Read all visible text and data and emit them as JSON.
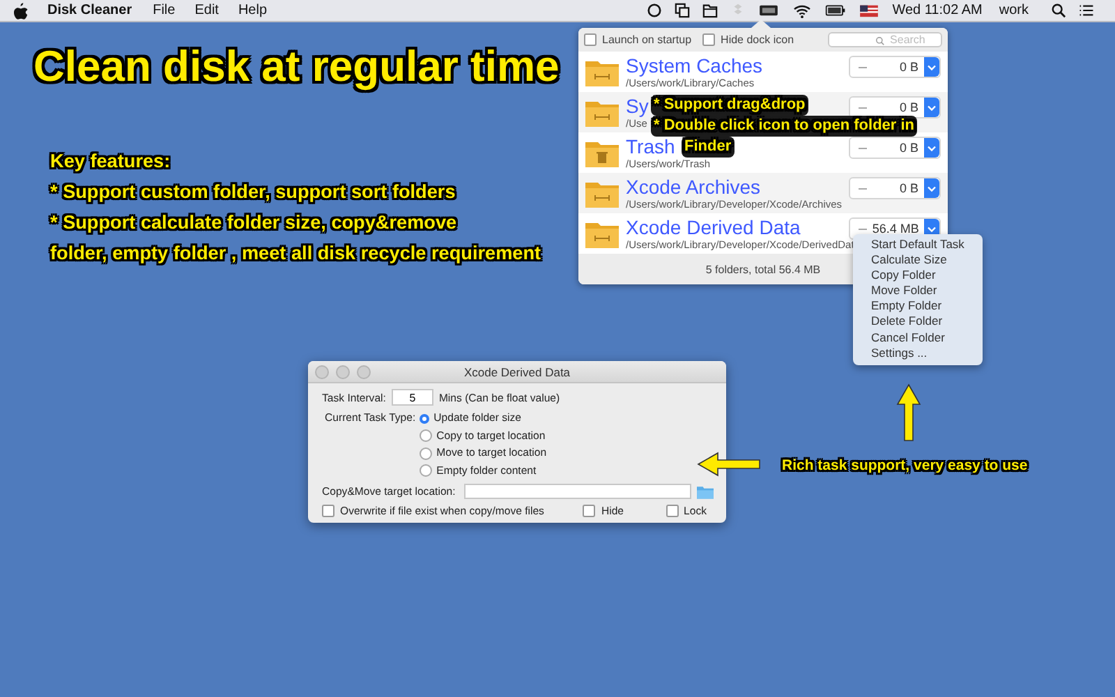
{
  "menu_bar": {
    "app_name": "Disk Cleaner",
    "menus": [
      "File",
      "Edit",
      "Help"
    ],
    "clock": "Wed 11:02 AM",
    "user": "work"
  },
  "headline": "Clean disk at regular time",
  "features": {
    "title": "Key features:",
    "lines": [
      "* Support custom folder, support sort folders",
      "* Support calculate folder size, copy&remove",
      "folder, empty folder  , meet all disk recycle requirement"
    ]
  },
  "popover": {
    "options": [
      {
        "label": "Launch on startup",
        "checked": false
      },
      {
        "label": "Hide dock icon",
        "checked": false
      }
    ],
    "search": {
      "placeholder": "Search"
    },
    "folders": [
      {
        "name": "System Caches",
        "path": "/Users/work/Library/Caches",
        "size": "0 B",
        "kind": "folder"
      },
      {
        "name": "Sy",
        "path": "/Use",
        "size": "0 B",
        "kind": "folder"
      },
      {
        "name": "Trash",
        "path": "/Users/work/Trash",
        "size": "0 B",
        "kind": "trash"
      },
      {
        "name": "Xcode Archives",
        "path": "/Users/work/Library/Developer/Xcode/Archives",
        "size": "0 B",
        "kind": "folder"
      },
      {
        "name": "Xcode Derived Data",
        "path": "/Users/work/Library/Developer/Xcode/DerivedDat",
        "size": "56.4 MB",
        "kind": "folder"
      }
    ],
    "footer": "5 folders, total 56.4 MB"
  },
  "popover_note": [
    "* Support drag&drop",
    "* Double click icon to open folder in",
    "Finder"
  ],
  "context_menu": [
    "Start Default Task",
    "Calculate Size",
    "Copy Folder",
    "Move Folder",
    "Empty Folder",
    "Delete Folder",
    "Cancel Folder",
    "Settings ..."
  ],
  "dialog": {
    "title": "Xcode Derived Data",
    "interval_label": "Task Interval:",
    "interval_value": "5",
    "interval_unit": "Mins (Can be float value)",
    "task_type_label": "Current Task  Type:",
    "task_types": [
      {
        "label": "Update folder size",
        "selected": true
      },
      {
        "label": "Copy to target location",
        "selected": false
      },
      {
        "label": "Move to target location",
        "selected": false
      },
      {
        "label": "Empty folder content",
        "selected": false
      }
    ],
    "target_label": "Copy&Move target location:",
    "checkboxes": [
      {
        "label": "Overwrite if file exist when copy/move files",
        "checked": false
      },
      {
        "label": "Hide",
        "checked": false
      },
      {
        "label": "Lock",
        "checked": false
      }
    ]
  },
  "dialog_note": "Rich task support, very easy to use"
}
